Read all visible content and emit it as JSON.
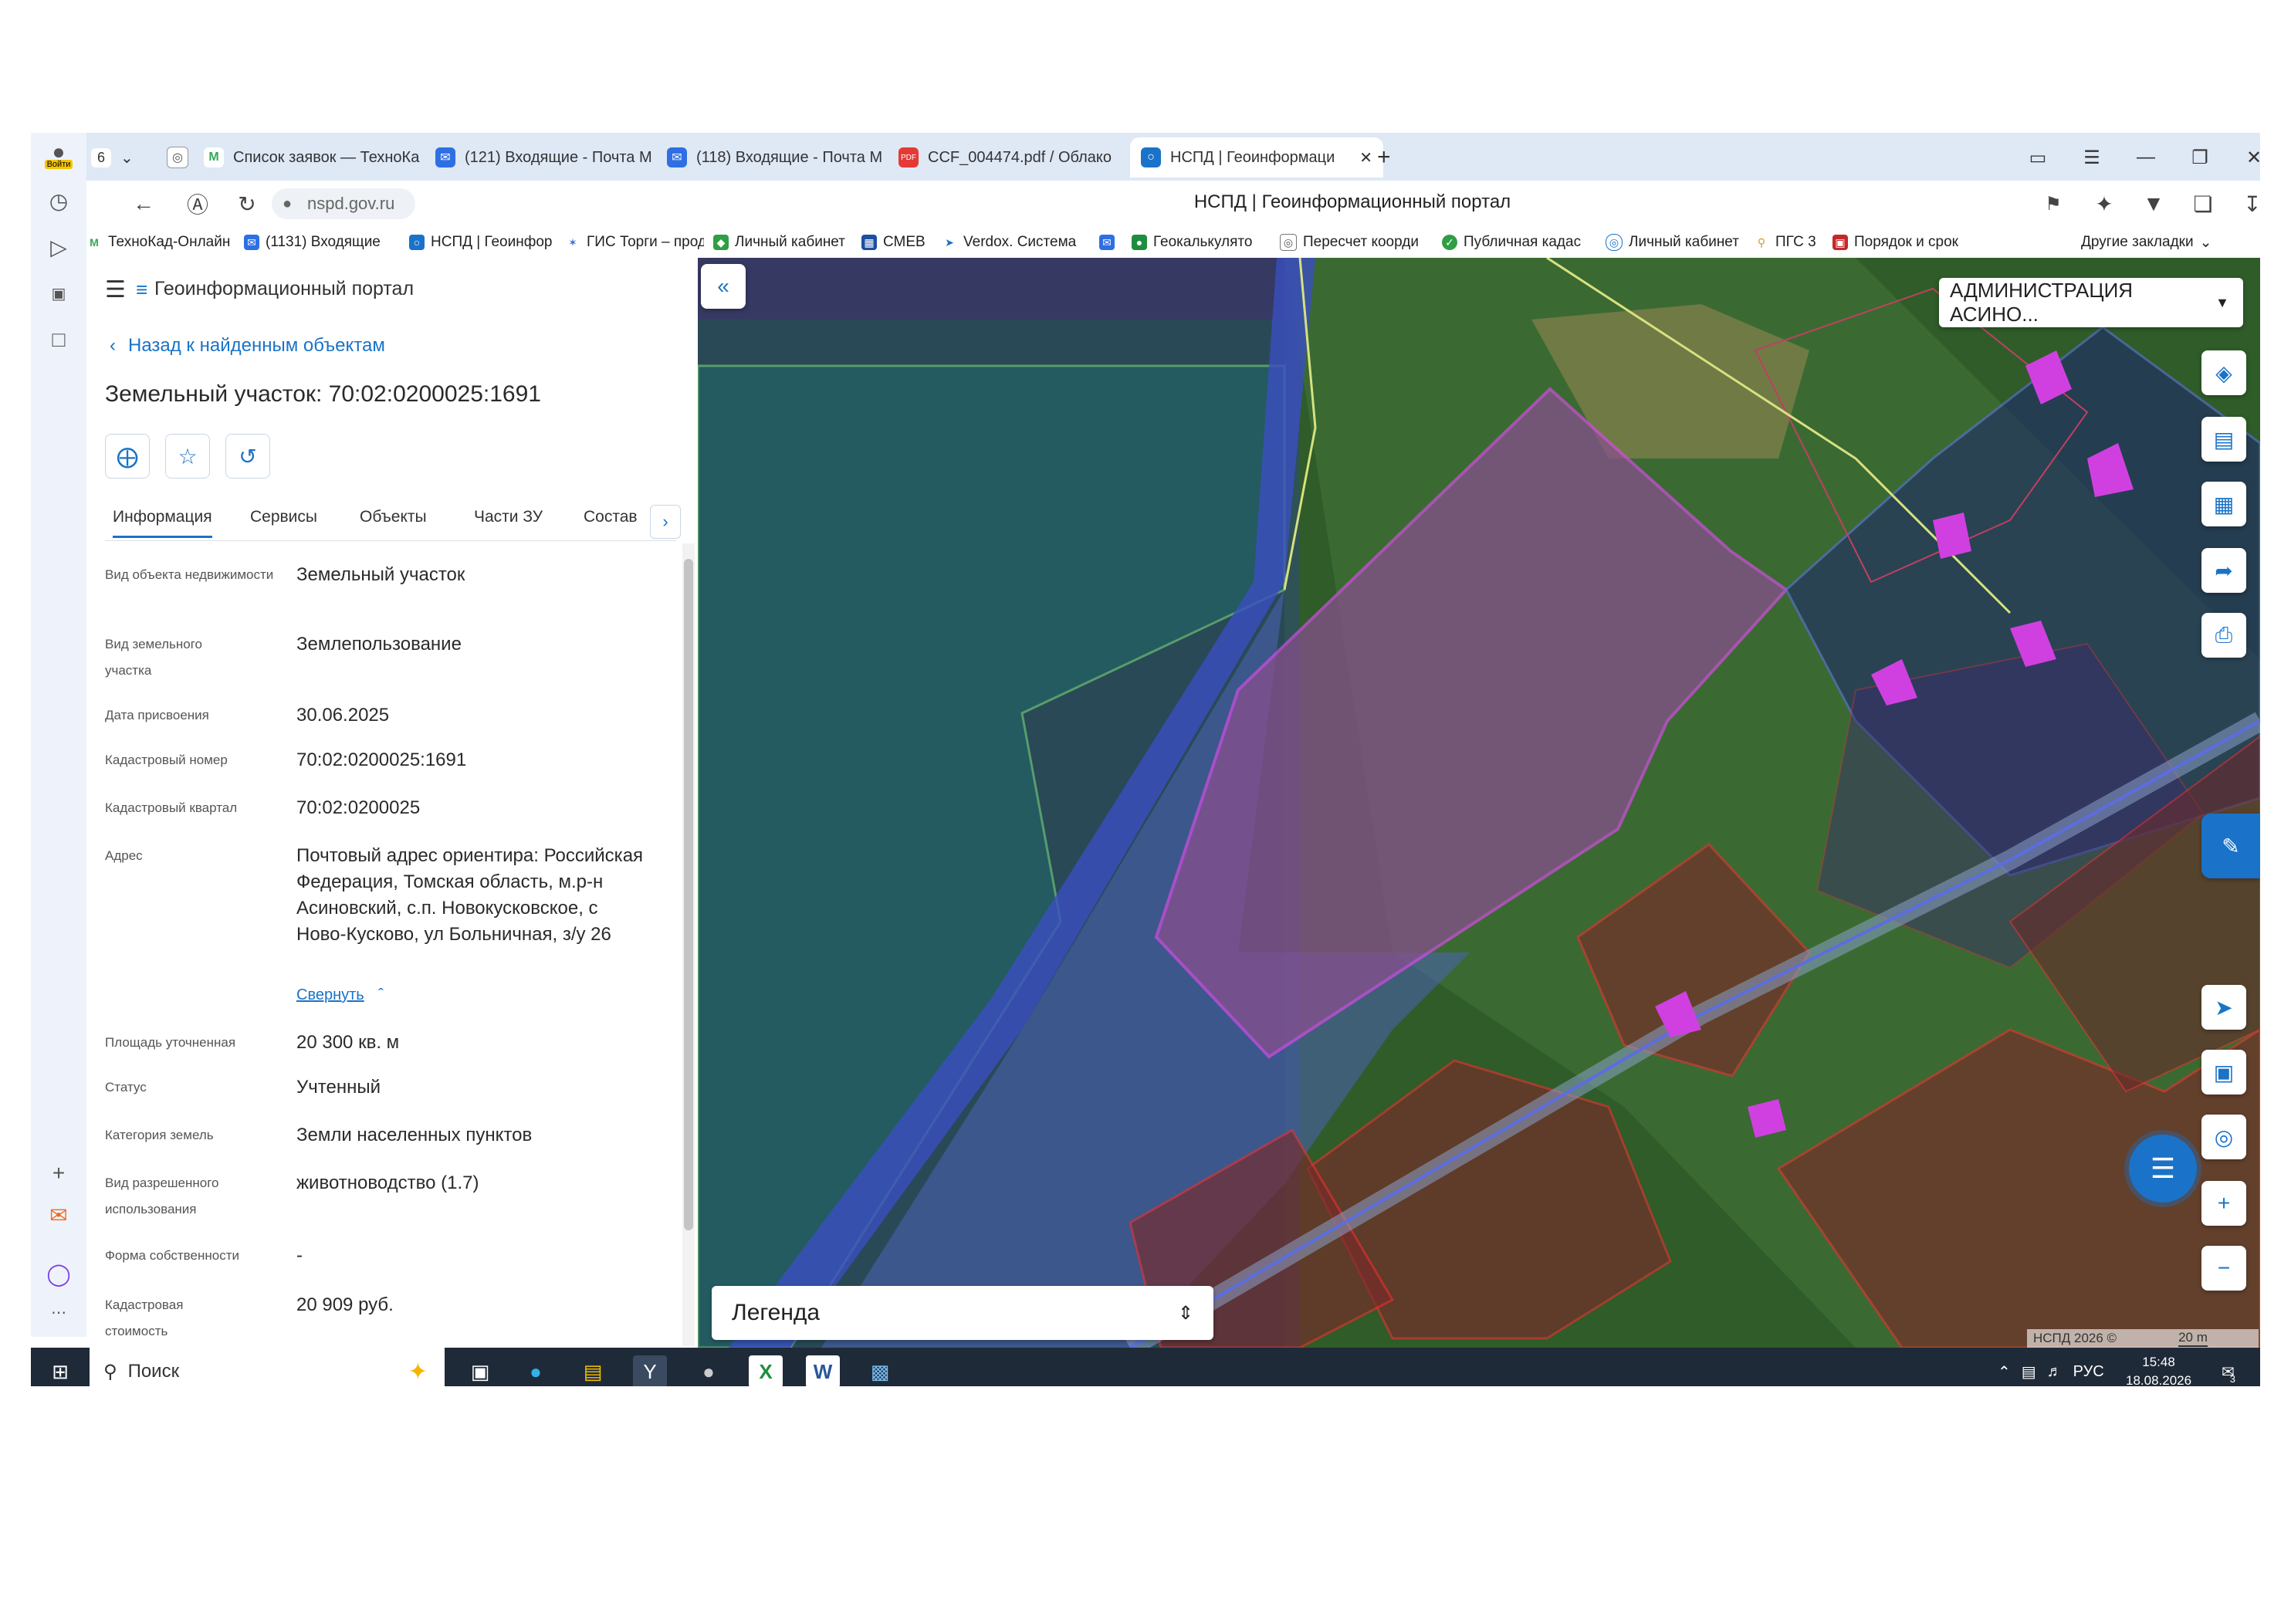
{
  "browser": {
    "profile_label": "Войти",
    "tab_count": "6",
    "tabs": [
      {
        "label": "Список заявок — ТехноКа",
        "icon": "gmail-icon"
      },
      {
        "label": "(121) Входящие - Почта М",
        "icon": "mail-icon"
      },
      {
        "label": "(118) Входящие - Почта М",
        "icon": "mail-icon"
      },
      {
        "label": "CCF_004474.pdf / Облако",
        "icon": "pdf-icon"
      },
      {
        "label": "НСПД | Геоинформаци",
        "icon": "nspd-icon"
      }
    ],
    "new_tab": "+",
    "url": "nspd.gov.ru",
    "page_title": "НСПД | Геоинформационный портал",
    "bookmarks": [
      "ТехноКад-Онлайн",
      "(1131) Входящие",
      "НСПД | Геоинфор",
      "ГИС Торги – прод",
      "Личный кабинет",
      "СМЕВ",
      "Verdox. Система",
      "",
      "Геокалькулято",
      "Пересчет коорди",
      "Публичная кадас",
      "Личный кабинет",
      "ПГС 3",
      "Порядок и срок"
    ],
    "other_bookmarks": "Другие закладки"
  },
  "panel": {
    "portal_title": "Геоинформационный портал",
    "back_link": "Назад к найденным объектам",
    "object_title": "Земельный участок: 70:02:0200025:1691",
    "tabs": [
      "Информация",
      "Сервисы",
      "Объекты",
      "Части ЗУ",
      "Состав"
    ],
    "attributes": [
      {
        "key": "Вид объекта недвижимости",
        "value": "Земельный участок"
      },
      {
        "key": "Вид земельного участка",
        "value": "Землепользование"
      },
      {
        "key": "Дата присвоения",
        "value": "30.06.2025"
      },
      {
        "key": "Кадастровый номер",
        "value": "70:02:0200025:1691"
      },
      {
        "key": "Кадастровый квартал",
        "value": "70:02:0200025"
      },
      {
        "key": "Адрес",
        "value": "Почтовый адрес ориентира: Российская Федерация, Томская область, м.р-н Асиновский, с.п. Новокусковское, с Ново-Кусково, ул Больничная, з/у 26"
      },
      {
        "key": "Площадь уточненная",
        "value": "20 300 кв. м"
      },
      {
        "key": "Статус",
        "value": "Учтенный"
      },
      {
        "key": "Категория земель",
        "value": "Земли населенных пунктов"
      },
      {
        "key": "Вид разрешенного использования",
        "value": "животноводство (1.7)"
      },
      {
        "key": "Форма собственности",
        "value": "-"
      },
      {
        "key": "Кадастровая стоимость",
        "value": "20 909 руб."
      }
    ],
    "collapse_link": "Свернуть"
  },
  "map": {
    "admin_select": "АДМИНИСТРАЦИЯ АСИНО...",
    "legend_label": "Легенда",
    "copyright": "НСПД 2026 ©",
    "scale": "20 m"
  },
  "taskbar": {
    "search_placeholder": "Поиск",
    "lang": "РУС",
    "time": "15:48",
    "date": "18.08.2026",
    "notifications": "3"
  }
}
